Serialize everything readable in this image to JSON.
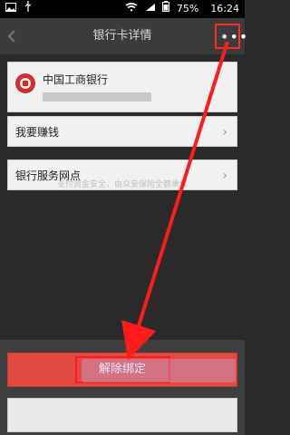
{
  "statusbar": {
    "battery": "75%",
    "time": "16:24"
  },
  "titlebar": {
    "title": "银行卡详情"
  },
  "bank": {
    "name": "中国工商银行"
  },
  "rows": [
    {
      "label": "我要赚钱"
    },
    {
      "label": "银行服务网点"
    }
  ],
  "note": "支付资金安全，由众安保险全额承保",
  "actions": {
    "unbind_label": "解除绑定",
    "cancel_label": ""
  },
  "icons": {
    "more": "more-icon",
    "chevron": "chevron-right-icon",
    "bank_logo": "icbc-logo",
    "wifi": "wifi-icon",
    "signal": "signal-icon",
    "battery": "battery-icon",
    "image": "image-icon",
    "usb": "usb-icon",
    "back": "back-icon"
  },
  "colors": {
    "titlebar": "#3b3b3b",
    "primary_action": "#e14b43",
    "highlight": "#ff1b1b"
  }
}
